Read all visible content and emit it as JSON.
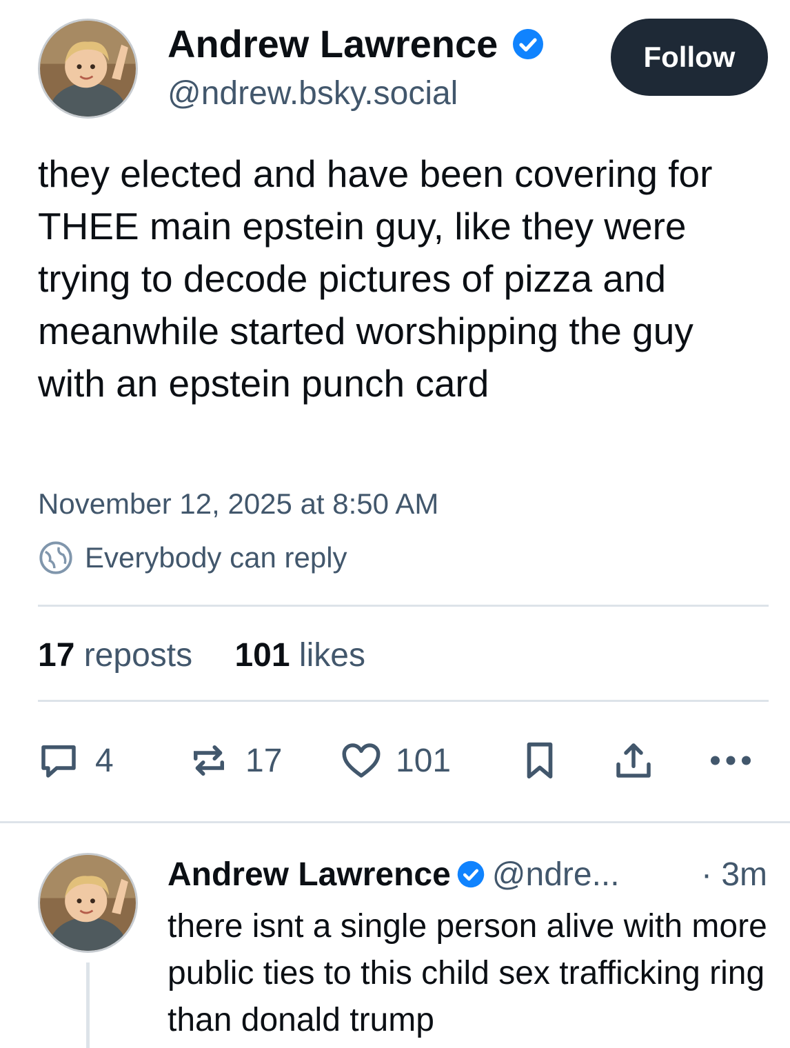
{
  "colors": {
    "text_primary": "#0b0f14",
    "text_secondary": "#42576c",
    "verified_blue": "#1083fe",
    "follow_bg": "#1e2936",
    "divider": "#dde3e9"
  },
  "post": {
    "author_name": "Andrew Lawrence",
    "author_handle": "@ndrew.bsky.social",
    "follow_label": "Follow",
    "text": "they elected and have been covering for THEE main epstein guy, like they were trying to decode pictures of pizza and meanwhile started worshipping the guy with an epstein punch card",
    "timestamp": "November 12, 2025 at 8:50 AM",
    "reply_setting": "Everybody can reply",
    "repost_count": "17",
    "repost_label": "reposts",
    "like_count": "101",
    "like_label": "likes",
    "actions": {
      "reply_count": "4",
      "repost_count": "17",
      "like_count": "101"
    },
    "icons": [
      "verified-badge-icon",
      "globe-icon",
      "reply-icon",
      "repost-icon",
      "heart-icon",
      "bookmark-icon",
      "share-icon",
      "more-icon"
    ]
  },
  "reply": {
    "author_name": "Andrew Lawrence",
    "author_handle": "@ndre...",
    "time": "· 3m",
    "text": "there isnt a single person alive with more public ties to this child sex trafficking ring than donald trump"
  }
}
